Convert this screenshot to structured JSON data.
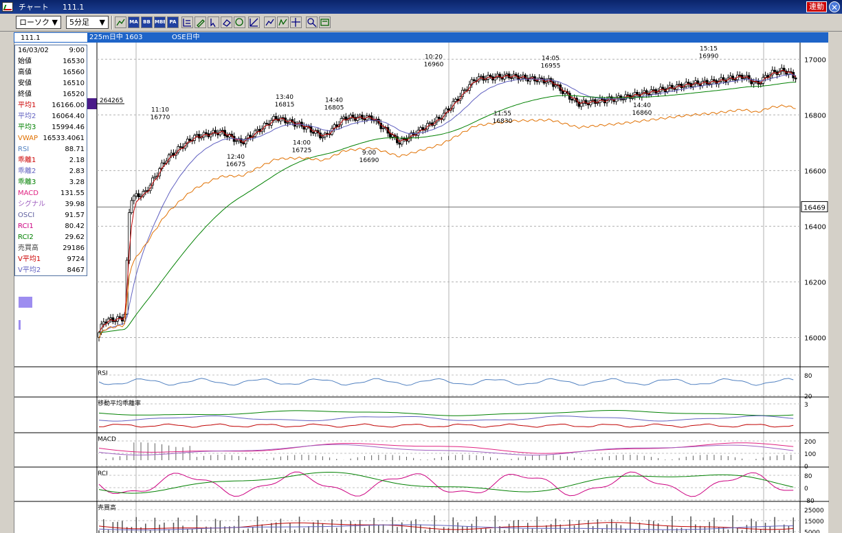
{
  "window": {
    "title": "チャート",
    "symbol": "111.1",
    "link_label": "連動",
    "close_icon": "close-icon"
  },
  "toolbar": {
    "chart_type": "ローソク",
    "interval": "5分足",
    "buttons": [
      {
        "name": "chart-settings-icon",
        "label": "",
        "style": "plain"
      },
      {
        "name": "ma-button",
        "label": "MA",
        "style": "blue"
      },
      {
        "name": "bb-button",
        "label": "BB",
        "style": "blue"
      },
      {
        "name": "mbe-button",
        "label": "MBE",
        "style": "blue"
      },
      {
        "name": "pa-button",
        "label": "PA",
        "style": "blue"
      },
      {
        "name": "line-chart-icon",
        "label": "",
        "style": "plain"
      },
      {
        "name": "zigzag-icon",
        "label": "",
        "style": "plain"
      },
      {
        "name": "crosshair-icon",
        "label": "",
        "style": "plain"
      },
      {
        "name": "zoom-icon",
        "label": "",
        "style": "plain"
      },
      {
        "name": "print-icon",
        "label": "",
        "style": "plain"
      },
      {
        "name": "grid-icon",
        "label": "",
        "style": "plain"
      },
      {
        "name": "pencil-icon",
        "label": "",
        "style": "plain"
      },
      {
        "name": "cursor-icon",
        "label": "",
        "style": "plain"
      },
      {
        "name": "eraser-icon",
        "label": "",
        "style": "plain"
      },
      {
        "name": "settings-icon",
        "label": "",
        "style": "plain"
      },
      {
        "name": "trendline-icon",
        "label": "",
        "style": "plain"
      }
    ]
  },
  "infobar": {
    "symbol": "111.1",
    "label_a": "225m日中 1603",
    "label_b": "OSE日中"
  },
  "data_panel": {
    "date": "16/03/02",
    "time": "9:00",
    "rows": [
      {
        "label": "始値",
        "value": "16530",
        "color": "#000000"
      },
      {
        "label": "高値",
        "value": "16560",
        "color": "#000000"
      },
      {
        "label": "安値",
        "value": "16510",
        "color": "#000000"
      },
      {
        "label": "終値",
        "value": "16520",
        "color": "#000000"
      },
      {
        "label": "平均1",
        "value": "16166.00",
        "color": "#cc0000"
      },
      {
        "label": "平均2",
        "value": "16064.40",
        "color": "#6060c0"
      },
      {
        "label": "平均3",
        "value": "15994.46",
        "color": "#008000"
      },
      {
        "label": "VWAP",
        "value": "16533.4061",
        "color": "#e07000"
      },
      {
        "label": "RSI",
        "value": "88.71",
        "color": "#5080c0"
      },
      {
        "label": "乖離1",
        "value": "2.18",
        "color": "#cc0000"
      },
      {
        "label": "乖離2",
        "value": "2.83",
        "color": "#6060c0"
      },
      {
        "label": "乖離3",
        "value": "3.28",
        "color": "#008000"
      },
      {
        "label": "MACD",
        "value": "131.55",
        "color": "#e02080"
      },
      {
        "label": "シグナル",
        "value": "39.98",
        "color": "#a060c0"
      },
      {
        "label": "OSCI",
        "value": "91.57",
        "color": "#6060a0"
      },
      {
        "label": "RCI1",
        "value": "80.42",
        "color": "#cc0080"
      },
      {
        "label": "RCI2",
        "value": "29.62",
        "color": "#008000"
      },
      {
        "label": "売買高",
        "value": "29186",
        "color": "#404040"
      },
      {
        "label": "V平均1",
        "value": "9724",
        "color": "#cc0000"
      },
      {
        "label": "V平均2",
        "value": "8467",
        "color": "#6060c0"
      }
    ]
  },
  "chart_data": {
    "type": "candlestick",
    "price_axis": {
      "ylim": [
        15900,
        17050
      ],
      "ticks": [
        16000,
        16200,
        16400,
        16600,
        16800,
        17000
      ]
    },
    "current_price": "16469",
    "left_marker": "264265",
    "annotations": [
      {
        "time": "11:10",
        "price": 16770,
        "pos": "high"
      },
      {
        "time": "12:40",
        "price": 16675,
        "pos": "low"
      },
      {
        "time": "13:40",
        "price": 16815,
        "pos": "high"
      },
      {
        "time": "14:00",
        "price": 16725,
        "pos": "low"
      },
      {
        "time": "14:40",
        "price": 16805,
        "pos": "high"
      },
      {
        "time": "9:00",
        "price": 16690,
        "pos": "low"
      },
      {
        "time": "10:20",
        "price": 16960,
        "pos": "high"
      },
      {
        "time": "11:55",
        "price": 16830,
        "pos": "low"
      },
      {
        "time": "14:05",
        "price": 16955,
        "pos": "high"
      },
      {
        "time": "14:40",
        "price": 16860,
        "pos": "low"
      },
      {
        "time": "15:15",
        "price": 16990,
        "pos": "high"
      }
    ],
    "panels": [
      {
        "name": "RSI",
        "title": "RSI",
        "ticks": [
          "80",
          "20"
        ]
      },
      {
        "name": "deviation",
        "title": "移動平均乖離率",
        "ticks": [
          "3"
        ]
      },
      {
        "name": "macd",
        "title": "MACD",
        "ticks": [
          "200",
          "100",
          "0"
        ]
      },
      {
        "name": "rci",
        "title": "RCI",
        "ticks": [
          "80",
          "0",
          "-80"
        ]
      },
      {
        "name": "volume",
        "title": "売買高",
        "ticks": [
          "25000",
          "15000",
          "5000"
        ]
      }
    ],
    "grid": true
  }
}
